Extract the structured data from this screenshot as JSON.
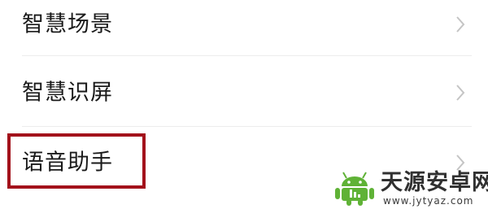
{
  "settings_list": {
    "items": [
      {
        "label": "智慧场景",
        "chevron": "chevron-right-icon"
      },
      {
        "label": "智慧识屏",
        "chevron": "chevron-right-icon"
      },
      {
        "label": "语音助手",
        "chevron": "chevron-right-icon"
      }
    ]
  },
  "highlight": {
    "color": "#a3121b",
    "target": "语音助手"
  },
  "watermark": {
    "name": "天源安卓网",
    "url": "www.jytyaz.com",
    "logo": "android-robot-icon",
    "logo_color": "#5fb236"
  }
}
